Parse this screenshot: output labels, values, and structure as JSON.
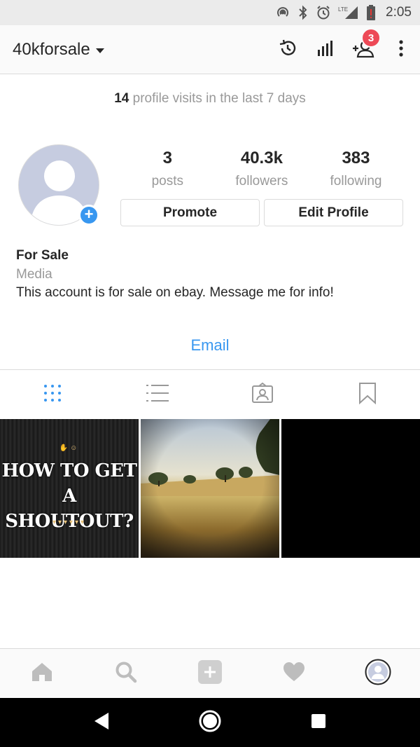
{
  "status_bar": {
    "time": "2:05",
    "network": "LTE",
    "icons": [
      "hotspot-icon",
      "bluetooth-icon",
      "alarm-icon",
      "signal-icon",
      "battery-alert-icon"
    ]
  },
  "header": {
    "username": "40kforsale",
    "icons": [
      "history-icon",
      "insights-icon",
      "discover-people-icon",
      "more-icon"
    ],
    "notification_count": "3"
  },
  "profile": {
    "visits_count": "14",
    "visits_text": " profile visits in the last 7 days",
    "stats": {
      "posts": {
        "value": "3",
        "label": "posts"
      },
      "followers": {
        "value": "40.3k",
        "label": "followers"
      },
      "following": {
        "value": "383",
        "label": "following"
      }
    },
    "promote_label": "Promote",
    "edit_label": "Edit Profile",
    "name": "For Sale",
    "category": "Media",
    "bio": "This account is for sale on ebay. Message me for info!",
    "email_label": "Email"
  },
  "tabs": [
    "grid-icon",
    "list-icon",
    "tagged-icon",
    "saved-icon"
  ],
  "posts": {
    "first_post_line1": "HOW TO GET",
    "first_post_line2": "A SHOUTOUT?"
  },
  "bottom_nav": [
    "home-icon",
    "search-icon",
    "add-post-icon",
    "activity-icon",
    "profile-icon"
  ],
  "colors": {
    "accent": "#3897f0",
    "badge": "#ed4956",
    "avatar_bg": "#c6cce0"
  }
}
